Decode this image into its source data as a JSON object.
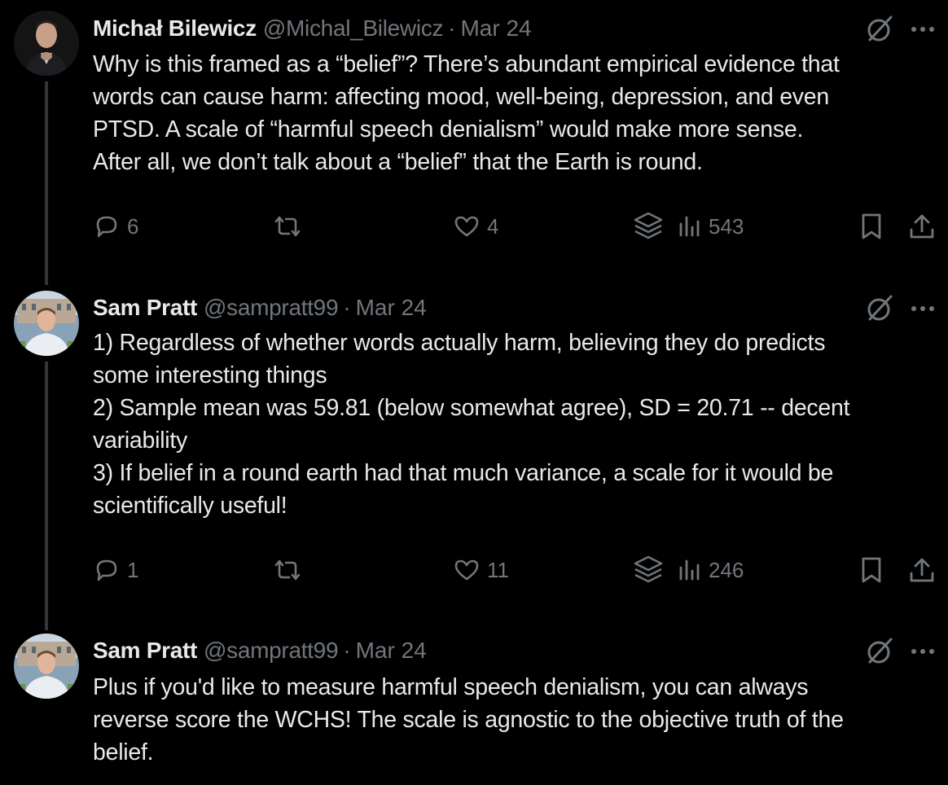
{
  "thread": {
    "tweets": [
      {
        "author": {
          "name": "Michał Bilewicz",
          "handle": "@Michal_Bilewicz"
        },
        "date": "Mar 24",
        "text_lines": [
          "Why is this framed as a “belief”? There’s abundant empirical evidence that",
          "words can cause harm: affecting mood, well-being, depression, and even",
          "PTSD. A scale of “harmful speech denialism” would make more sense.",
          "After all, we don’t talk about a “belief” that the Earth is round."
        ],
        "stats": {
          "replies": "6",
          "likes": "4",
          "views": "543"
        }
      },
      {
        "author": {
          "name": "Sam Pratt",
          "handle": "@sampratt99"
        },
        "date": "Mar 24",
        "text_lines": [
          "1) Regardless of whether words actually harm, believing they do predicts",
          "some interesting things",
          "2) Sample mean was 59.81 (below somewhat agree), SD = 20.71 -- decent",
          "variability",
          "3) If belief in a round earth had that much variance, a scale for it would be",
          "scientifically useful!"
        ],
        "stats": {
          "replies": "1",
          "likes": "11",
          "views": "246"
        }
      },
      {
        "author": {
          "name": "Sam Pratt",
          "handle": "@sampratt99"
        },
        "date": "Mar 24",
        "text_lines": [
          "Plus if you'd like to measure harmful speech denialism, you can always",
          "reverse score the WCHS! The scale is agnostic to the objective truth of the",
          "belief."
        ]
      }
    ],
    "dot_separator": "·"
  },
  "icons": {
    "reply": "reply-icon",
    "retweet": "retweet-icon",
    "like": "heart-icon",
    "grok": "grok-stack-icon",
    "views": "views-bar-icon",
    "bookmark": "bookmark-icon",
    "share": "share-icon",
    "header_grok": "grok-slash-icon",
    "more": "more-dots-icon"
  },
  "colors": {
    "background": "#000000",
    "text_primary": "#e7e9ea",
    "text_secondary": "#71767b",
    "thread_line": "#333639"
  }
}
